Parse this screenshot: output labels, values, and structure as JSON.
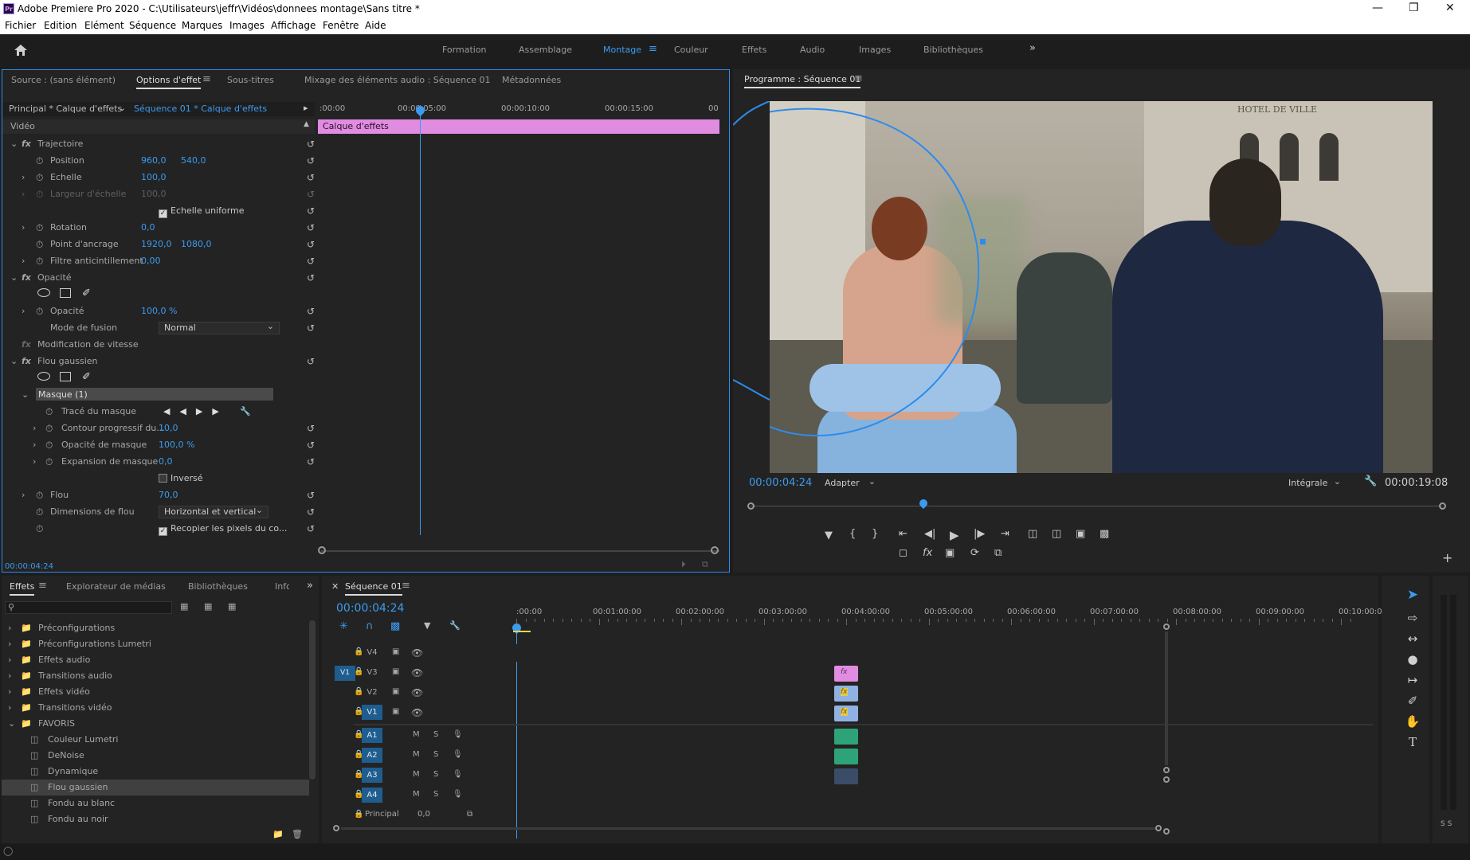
{
  "app": {
    "title": "Adobe Premiere Pro 2020 - C:\\Utilisateurs\\jeffr\\Vidéos\\donnees montage\\Sans titre *",
    "logo": "Pr"
  },
  "menu": [
    "Fichier",
    "Edition",
    "Elément",
    "Séquence",
    "Marques",
    "Images",
    "Affichage",
    "Fenêtre",
    "Aide"
  ],
  "workspaces": [
    "Formation",
    "Assemblage",
    "Montage",
    "Couleur",
    "Effets",
    "Audio",
    "Images",
    "Bibliothèques"
  ],
  "workspace_active": "Montage",
  "icons": [
    "home-icon",
    "chevrons-right-icon",
    "hamburger-icon",
    "reset-icon",
    "stopwatch-icon",
    "ellipse-mask-icon",
    "rectangle-mask-icon",
    "pen-icon",
    "wrench-icon",
    "lock-icon",
    "eye-icon",
    "film-icon",
    "mic-icon",
    "folder-icon",
    "search-icon",
    "marker-icon",
    "play-icon",
    "camera-icon",
    "selection-tool-icon",
    "hand-tool-icon",
    "type-tool-icon"
  ],
  "source_panel": {
    "tabs": [
      "Source : (sans élément)",
      "Options d'effet",
      "Sous-titres",
      "Mixage des éléments audio : Séquence 01",
      "Métadonnées"
    ],
    "active_tab": "Options d'effet",
    "clip_selector": "Principal * Calque d'effets",
    "sequence_selector": "Séquence 01 * Calque d'effets",
    "ruler": [
      ":00:00",
      "00:00:05:00",
      "00:00:10:00",
      "00:00:15:00",
      "00"
    ],
    "clip_bar": "Calque d'effets",
    "section_video": "Vidéo",
    "timecode": "00:00:04:24",
    "rows": {
      "trajectoire": "Trajectoire",
      "position": {
        "label": "Position",
        "v1": "960,0",
        "v2": "540,0"
      },
      "echelle": {
        "label": "Echelle",
        "v1": "100,0"
      },
      "largeur": {
        "label": "Largeur d'échelle",
        "v1": "100,0"
      },
      "echelle_uniforme": "Echelle uniforme",
      "rotation": {
        "label": "Rotation",
        "v1": "0,0"
      },
      "ancrage": {
        "label": "Point d'ancrage",
        "v1": "1920,0",
        "v2": "1080,0"
      },
      "anti": {
        "label": "Filtre anticintillement",
        "v1": "0,00"
      },
      "opacite_fx": "Opacité",
      "opacite": {
        "label": "Opacité",
        "v1": "100,0 %"
      },
      "fusion": {
        "label": "Mode de fusion",
        "v1": "Normal"
      },
      "vitesse": "Modification de vitesse",
      "flou_fx": "Flou gaussien",
      "masque": "Masque (1)",
      "trace": "Tracé du masque",
      "contour": {
        "label": "Contour progressif du...",
        "v1": "10,0"
      },
      "opacite_masque": {
        "label": "Opacité de masque",
        "v1": "100,0 %"
      },
      "expansion": {
        "label": "Expansion de masque",
        "v1": "0,0"
      },
      "inverse": "Inversé",
      "flou": {
        "label": "Flou",
        "v1": "70,0"
      },
      "dimensions": {
        "label": "Dimensions de flou",
        "v1": "Horizontal et vertical"
      },
      "recopier": "Recopier les pixels du co..."
    }
  },
  "program": {
    "title": "Programme : Séquence 01",
    "timecode": "00:00:04:24",
    "fit": "Adapter",
    "quality": "Intégrale",
    "duration": "00:00:19:08",
    "sign": "HOTEL DE VILLE",
    "playhead_fraction": 0.25
  },
  "effects_panel": {
    "tabs": [
      "Effets",
      "Explorateur de médias",
      "Bibliothèques",
      "Info"
    ],
    "active_tab": "Effets",
    "folders": [
      "Préconfigurations",
      "Préconfigurations Lumetri",
      "Effets audio",
      "Transitions audio",
      "Effets vidéo",
      "Transitions vidéo",
      "FAVORIS"
    ],
    "favorites": [
      "Couleur Lumetri",
      "DeNoise",
      "Dynamique",
      "Flou gaussien",
      "Fondu au blanc",
      "Fondu au noir"
    ],
    "selected": "Flou gaussien"
  },
  "timeline": {
    "title": "Séquence 01",
    "timecode": "00:00:04:24",
    "ruler": [
      ":00:00",
      "00:01:00:00",
      "00:02:00:00",
      "00:03:00:00",
      "00:04:00:00",
      "00:05:00:00",
      "00:06:00:00",
      "00:07:00:00",
      "00:08:00:00",
      "00:09:00:00",
      "00:10:00:00"
    ],
    "video_tracks": [
      "V4",
      "V3",
      "V2",
      "V1"
    ],
    "audio_tracks": [
      "A1",
      "A2",
      "A3",
      "A4"
    ],
    "source_patch_v": "V1",
    "ms": [
      "M",
      "S"
    ],
    "principal": "Principal",
    "principal_val": "0,0"
  },
  "audio_meter": "S S",
  "colors": {
    "accent": "#2d8ceb",
    "effect_layer": "#e08ce0",
    "video_clip": "#8fb2e3",
    "audio_clip": "#2ea37a"
  }
}
